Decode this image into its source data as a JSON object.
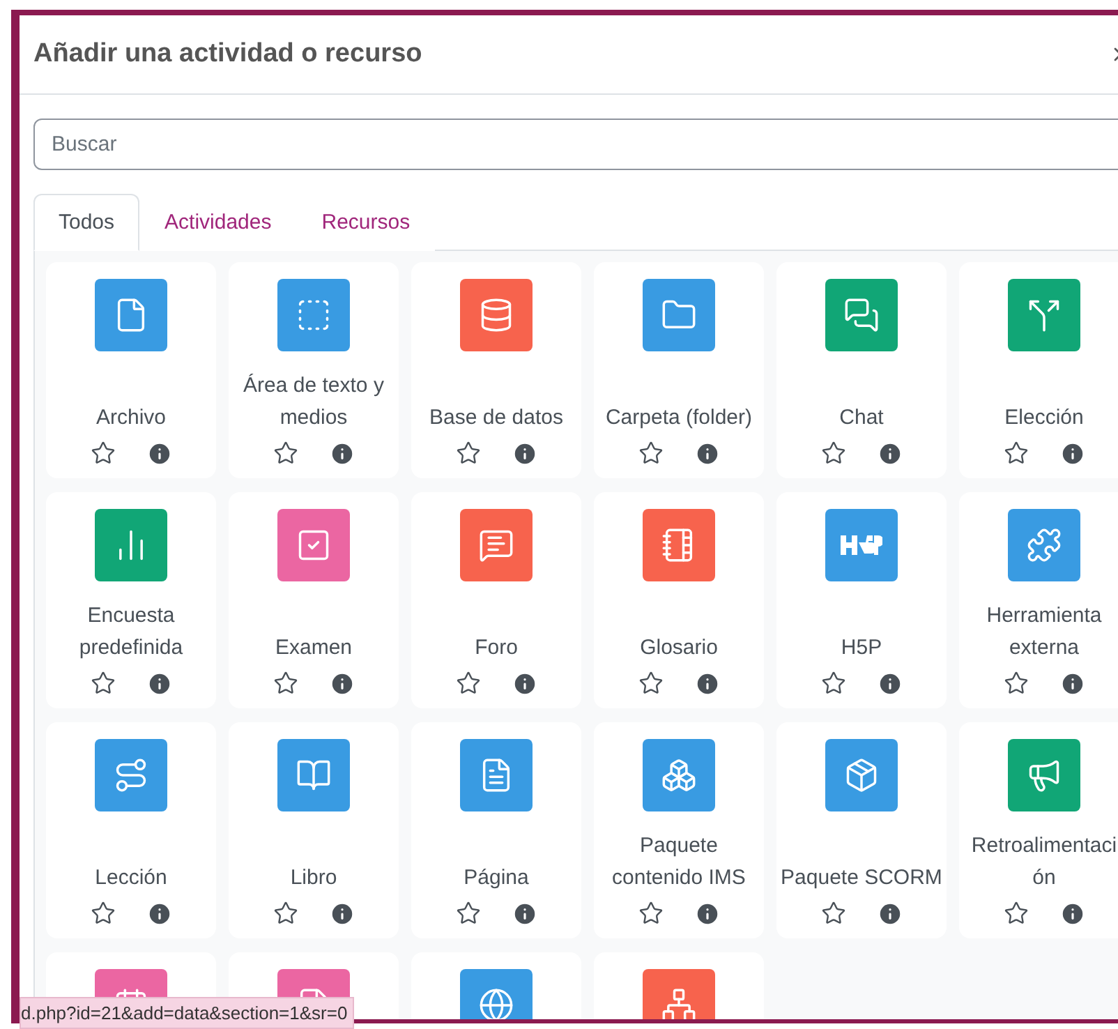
{
  "dialog": {
    "title": "Añadir una actividad o recurso"
  },
  "search": {
    "placeholder": "Buscar"
  },
  "tabs": [
    {
      "label": "Todos",
      "selected": true
    },
    {
      "label": "Actividades",
      "selected": false
    },
    {
      "label": "Recursos",
      "selected": false
    }
  ],
  "items": [
    {
      "name": "Archivo",
      "color": "#399be2",
      "starred": false
    },
    {
      "name": "Área de texto y medios",
      "color": "#399be2",
      "starred": false
    },
    {
      "name": "Base de datos",
      "color": "#f7634d",
      "starred": false
    },
    {
      "name": "Carpeta (folder)",
      "color": "#399be2",
      "starred": false
    },
    {
      "name": "Chat",
      "color": "#11a676",
      "starred": false
    },
    {
      "name": "Elección",
      "color": "#11a676",
      "starred": false
    },
    {
      "name": "Encuesta predefinida",
      "color": "#11a676",
      "starred": false
    },
    {
      "name": "Examen",
      "color": "#eb66a2",
      "starred": false
    },
    {
      "name": "Foro",
      "color": "#f7634d",
      "starred": false
    },
    {
      "name": "Glosario",
      "color": "#f7634d",
      "starred": false
    },
    {
      "name": "H5P",
      "color": "#399be2",
      "starred": false
    },
    {
      "name": "Herramienta externa",
      "color": "#399be2",
      "starred": false
    },
    {
      "name": "Lección",
      "color": "#399be2",
      "starred": false
    },
    {
      "name": "Libro",
      "color": "#399be2",
      "starred": false
    },
    {
      "name": "Página",
      "color": "#399be2",
      "starred": false
    },
    {
      "name": "Paquete contenido IMS",
      "color": "#399be2",
      "starred": false
    },
    {
      "name": "Paquete SCORM",
      "color": "#399be2",
      "starred": false
    },
    {
      "name": "Retroalimentaci ón",
      "color": "#11a676",
      "starred": false
    },
    {
      "color": "#eb66a2"
    },
    {
      "color": "#eb66a2"
    },
    {
      "color": "#399be2"
    },
    {
      "color": "#f7634d"
    }
  ],
  "status_bar": {
    "url": "d.php?id=21&add=data&section=1&sr=0"
  }
}
